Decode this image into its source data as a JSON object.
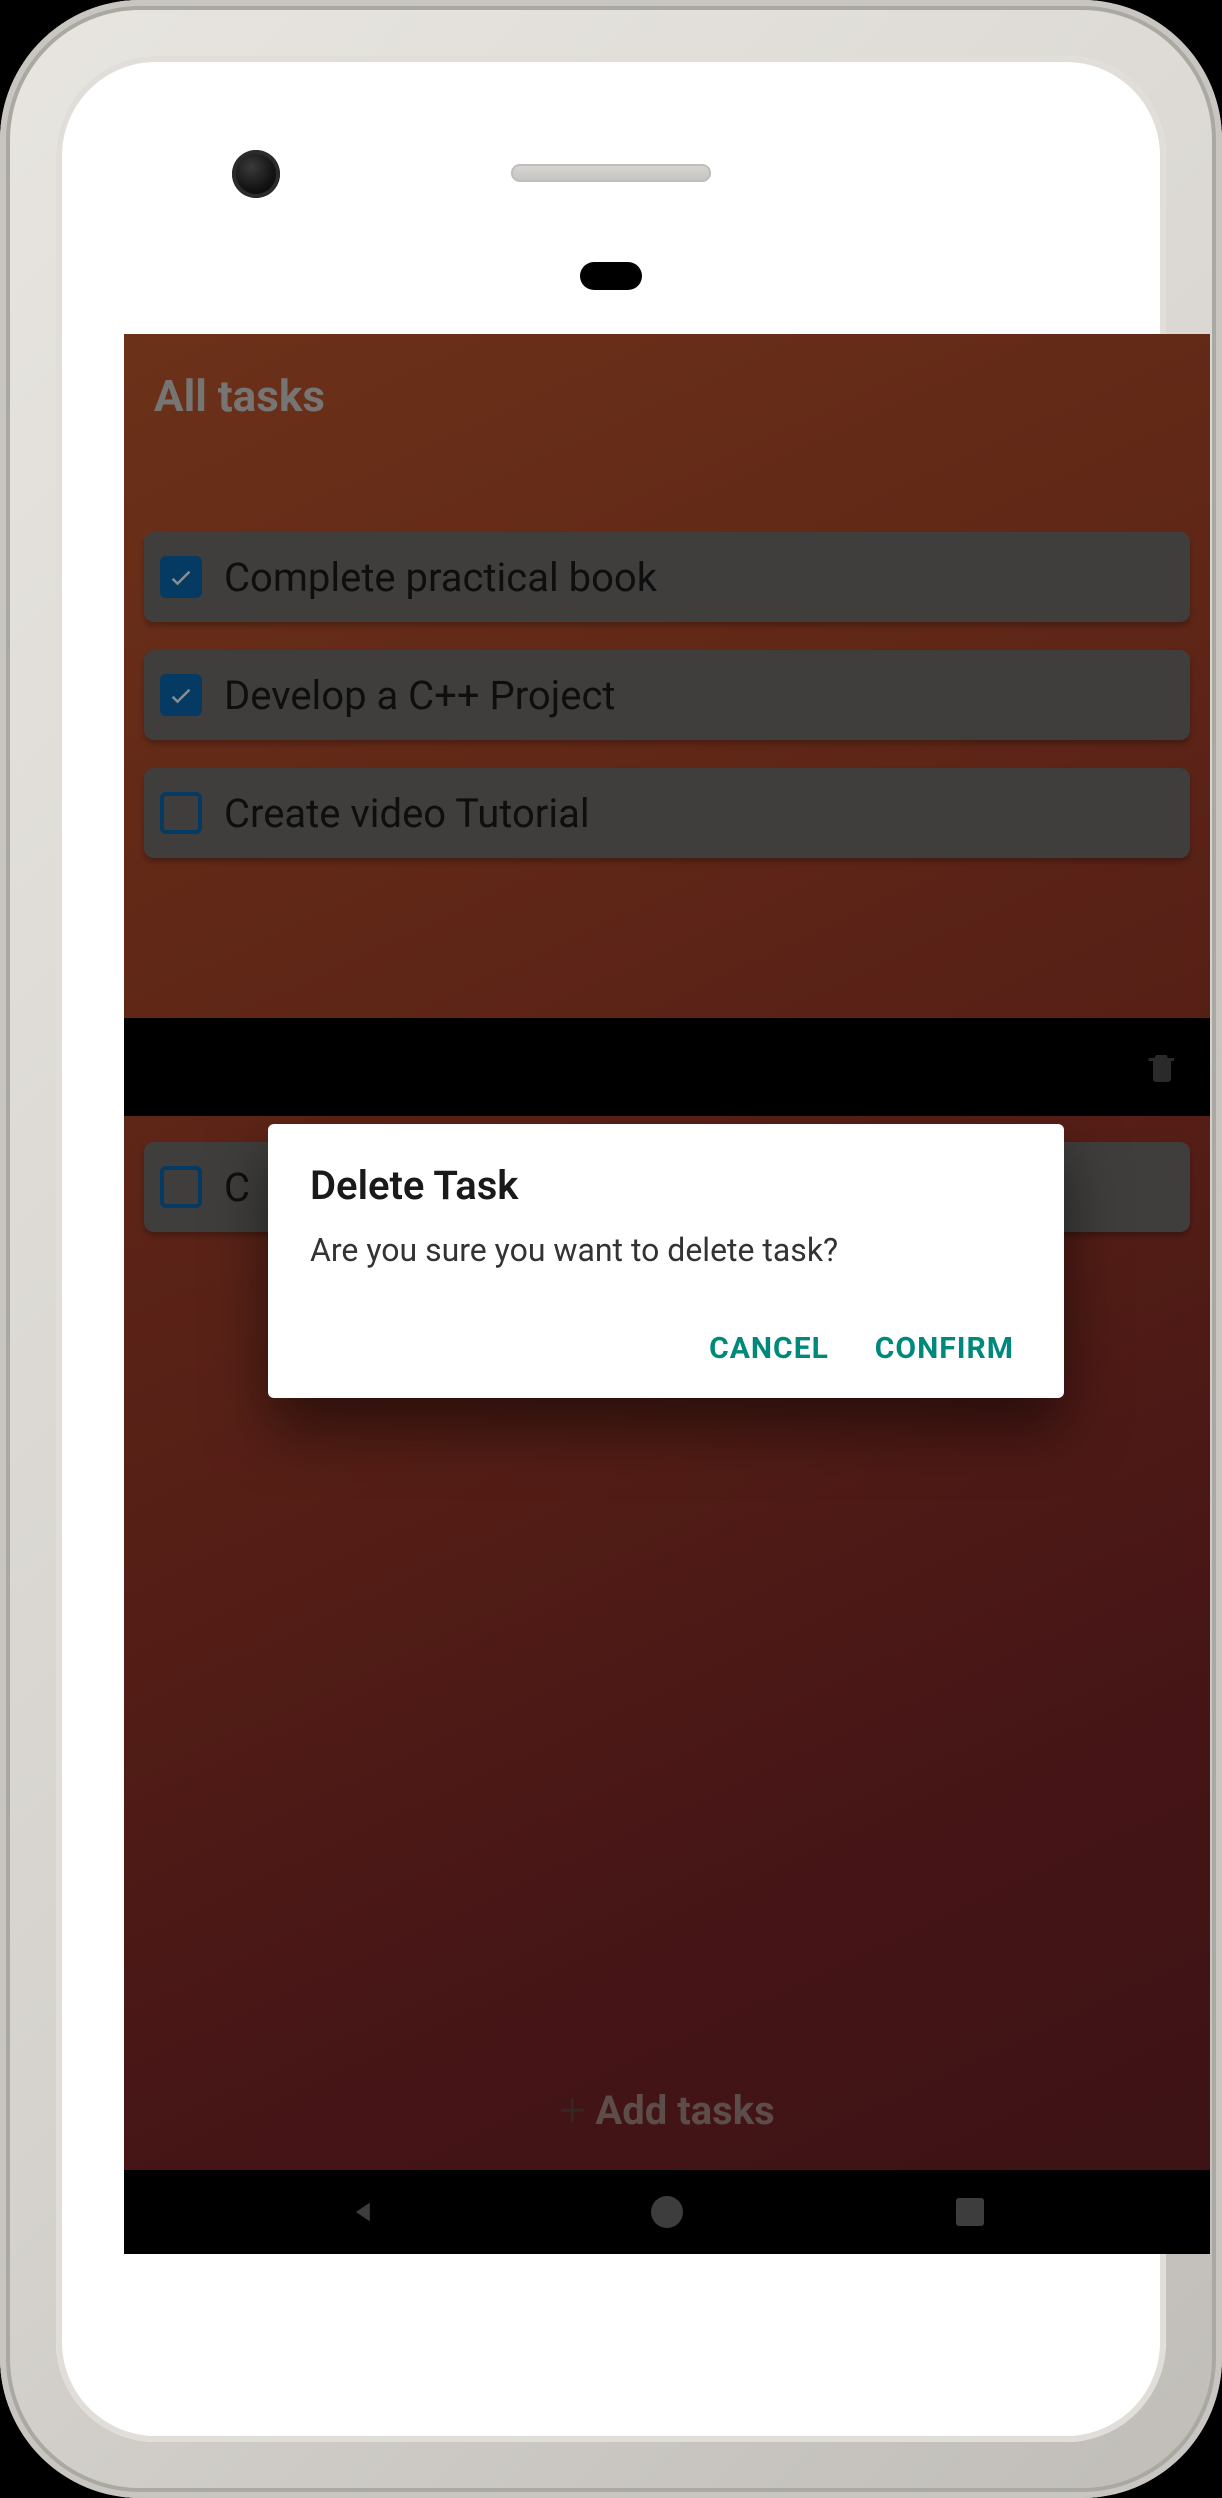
{
  "header": {
    "title": "All tasks"
  },
  "tasks": [
    {
      "label": "Complete practical book",
      "checked": true
    },
    {
      "label": "Develop a C++ Project",
      "checked": true
    },
    {
      "label": "Create video Tutorial",
      "checked": false
    },
    {
      "label": "C",
      "checked": false
    }
  ],
  "add_button": {
    "label": "Add tasks"
  },
  "dialog": {
    "title": "Delete Task",
    "message": "Are you sure you want to delete task?",
    "cancel": "CANCEL",
    "confirm": "CONFIRM"
  },
  "colors": {
    "accent_teal": "#00897b",
    "checkbox_blue": "#0a6ab5"
  }
}
